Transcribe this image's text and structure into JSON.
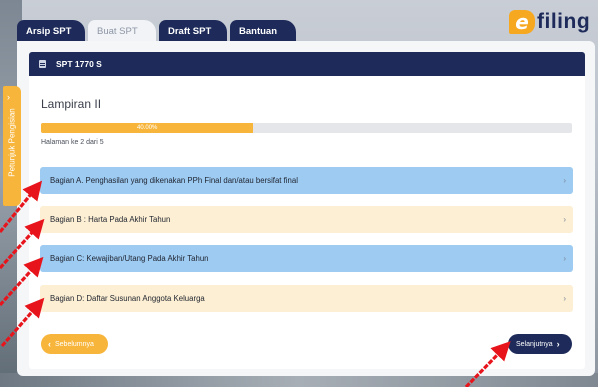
{
  "tabs": [
    {
      "label": "Arsip SPT",
      "active": false
    },
    {
      "label": "Buat SPT",
      "active": true
    },
    {
      "label": "Draft SPT",
      "active": false
    },
    {
      "label": "Bantuan",
      "active": false
    }
  ],
  "logo": {
    "mark": "e",
    "text": "filing"
  },
  "panel": {
    "header": "SPT 1770 S",
    "title": "Lampiran II",
    "progress": {
      "value": 0.4,
      "label": "40.00%"
    },
    "page_count": "Halaman ke 2 dari 5"
  },
  "sections": [
    {
      "label": "Bagian A. Penghasilan yang dikenakan PPh Final dan/atau bersifat final",
      "color": "#9ecbf2"
    },
    {
      "label": "Bagian B : Harta Pada Akhir Tahun",
      "color": "#fdefd3"
    },
    {
      "label": "Bagian C: Kewajiban/Utang Pada Akhir Tahun",
      "color": "#9ecbf2"
    },
    {
      "label": "Bagian D: Daftar Susunan Anggota Keluarga",
      "color": "#fdefd3"
    }
  ],
  "buttons": {
    "prev": "Sebelumnya",
    "next": "Selanjutnya"
  },
  "guide": {
    "label": "Petunjuk Pengisian"
  },
  "colors": {
    "navy": "#1e2b5a",
    "accent": "#f7b53b",
    "blue_row": "#9ecbf2",
    "cream_row": "#fdefd3",
    "arrow": "#e8141c"
  }
}
